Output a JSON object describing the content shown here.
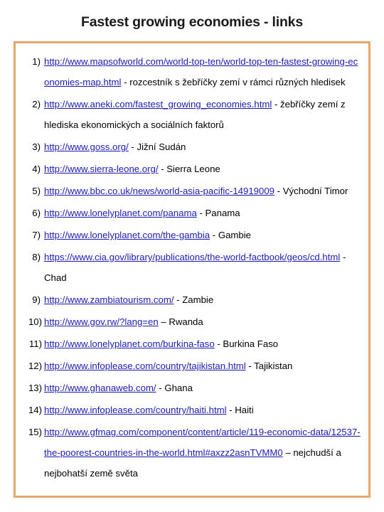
{
  "slide": {
    "title": "Fastest growing economies - links",
    "border_color": "#e5a86a",
    "link_color": "#1c1cb4",
    "text_color": "#000000",
    "background": "#ffffff"
  },
  "links": [
    {
      "marker": "1)",
      "url": "http://www.mapsofworld.com/world-top-ten/world-top-ten-fastest-growing-economies-map.html",
      "note": " - rozcestník s žebříčky zemí v rámci různých hledisek"
    },
    {
      "marker": "2)",
      "url": "http://www.aneki.com/fastest_growing_economies.html",
      "note": " - žebříčky zemí z hlediska ekonomických a sociálních faktorů"
    },
    {
      "marker": "3)",
      "url": "http://www.goss.org/",
      "note": " - Jižní Sudán"
    },
    {
      "marker": "4)",
      "url": "http://www.sierra-leone.org/",
      "note": " - Sierra Leone"
    },
    {
      "marker": "5)",
      "url": "http://www.bbc.co.uk/news/world-asia-pacific-14919009",
      "note": " - Východní Timor"
    },
    {
      "marker": "6)",
      "url": "http://www.lonelyplanet.com/panama",
      "note": " - Panama"
    },
    {
      "marker": "7)",
      "url": "http://www.lonelyplanet.com/the-gambia",
      "note": " - Gambie"
    },
    {
      "marker": "8)",
      "url": "https://www.cia.gov/library/publications/the-world-factbook/geos/cd.html",
      "note": " - Chad"
    },
    {
      "marker": "9)",
      "url": "http://www.zambiatourism.com/",
      "note": " - Zambie"
    },
    {
      "marker": "10)",
      "url": "http://www.gov.rw/?lang=en",
      "note": " – Rwanda"
    },
    {
      "marker": "11)",
      "url": "http://www.lonelyplanet.com/burkina-faso",
      "note": " - Burkina Faso"
    },
    {
      "marker": "12)",
      "url": "http://www.infoplease.com/country/tajikistan.html",
      "note": " - Tajikistan"
    },
    {
      "marker": "13)",
      "url": "http://www.ghanaweb.com/",
      "note": " - Ghana"
    },
    {
      "marker": "14)",
      "url": "http://www.infoplease.com/country/haiti.html",
      "note": " - Haiti"
    },
    {
      "marker": "15)",
      "url": "http://www.gfmag.com/component/content/article/119-economic-data/12537-the-poorest-countries-in-the-world.html#axzz2asnTVMM0",
      "note": " – nejchudší a nejbohatší země světa"
    }
  ]
}
